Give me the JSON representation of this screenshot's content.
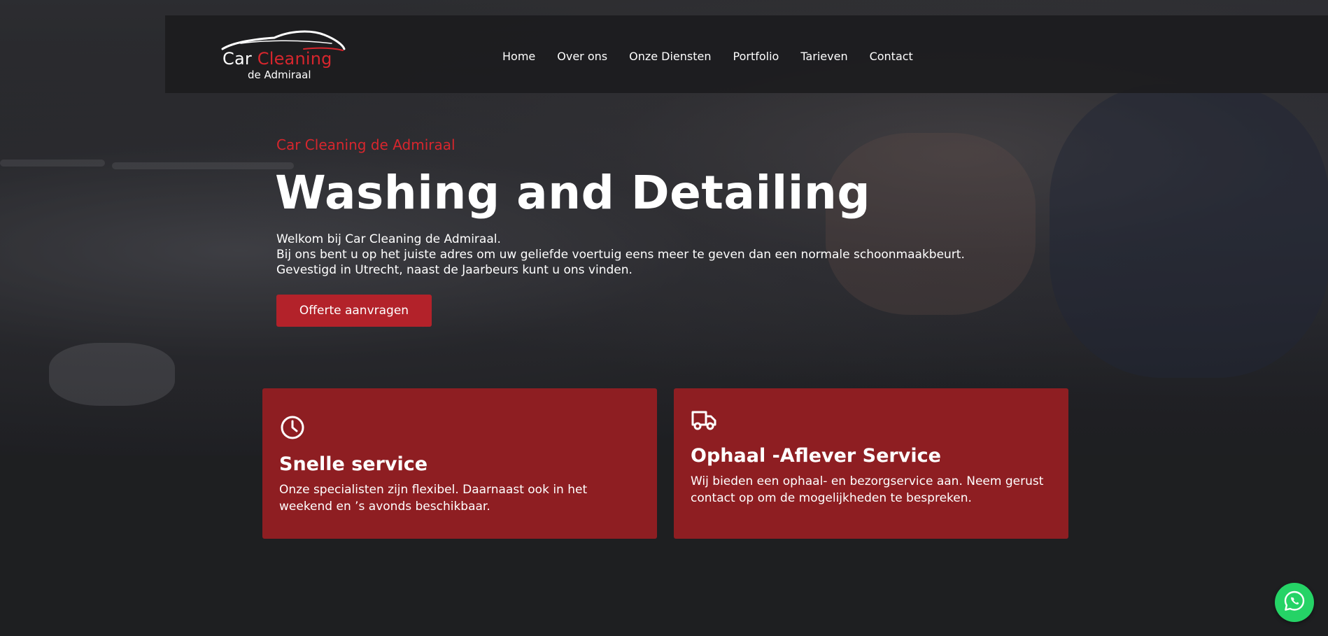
{
  "brand": {
    "name_part1": "Car ",
    "name_part2": "Cleaning",
    "tagline": "de Admiraal"
  },
  "nav": {
    "items": [
      {
        "label": "Home"
      },
      {
        "label": "Over ons"
      },
      {
        "label": "Onze Diensten"
      },
      {
        "label": "Portfolio"
      },
      {
        "label": "Tarieven"
      },
      {
        "label": "Contact"
      }
    ]
  },
  "hero": {
    "eyebrow": "Car Cleaning de Admiraal",
    "headline": "Washing and Detailing",
    "intro_lines": [
      "Welkom bij Car Cleaning de Admiraal.",
      "Bij ons bent u op het juiste adres om uw geliefde voertuig eens meer te geven dan een normale schoonmaakbeurt.",
      "Gevestigd in Utrecht, naast de Jaarbeurs kunt u ons vinden."
    ],
    "cta_label": "Offerte aanvragen"
  },
  "features": [
    {
      "icon": "clock-icon",
      "title": "Snelle service",
      "text": "Onze specialisten zijn flexibel. Daarnaast ook in het weekend en ’s avonds beschikbaar."
    },
    {
      "icon": "truck-icon",
      "title": "Ophaal -Aflever Service",
      "text": "Wij bieden een ophaal- en bezorgservice aan. Neem gerust contact op om de mogelijkheden te bespreken."
    }
  ],
  "floating": {
    "icon": "whatsapp-icon"
  },
  "colors": {
    "accent": "#d7262d",
    "card_bg": "#8e1e22",
    "button_bg": "#b3222a",
    "page_bg": "#1e1f21",
    "whatsapp": "#25d366"
  }
}
